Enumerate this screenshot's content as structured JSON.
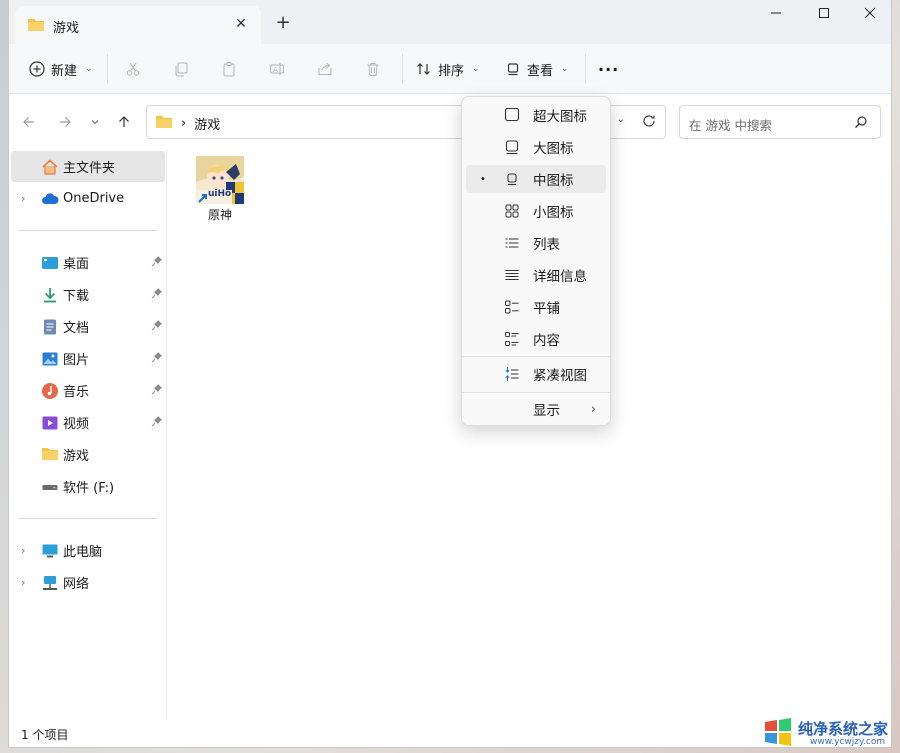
{
  "window": {
    "tab_title": "游戏",
    "tab_close": "✕",
    "new_tab": "+",
    "minimize": "—",
    "maximize": "☐",
    "close": "✕"
  },
  "toolbar": {
    "new_label": "新建",
    "sort_label": "排序",
    "view_label": "查看",
    "more_label": "···",
    "icons": [
      "cut-icon",
      "copy-icon",
      "paste-icon",
      "rename-icon",
      "share-icon",
      "delete-icon"
    ]
  },
  "address": {
    "crumb_separator": "›",
    "current_folder": "游戏",
    "search_placeholder": "在 游戏 中搜索"
  },
  "sidebar": {
    "items": [
      {
        "label": "主文件夹",
        "icon": "home-icon",
        "selected": true
      },
      {
        "label": "OneDrive",
        "icon": "cloud-icon",
        "expandable": true
      },
      {
        "label": "桌面",
        "icon": "desktop-icon",
        "pinned": true
      },
      {
        "label": "下载",
        "icon": "download-icon",
        "pinned": true
      },
      {
        "label": "文档",
        "icon": "document-icon",
        "pinned": true
      },
      {
        "label": "图片",
        "icon": "picture-icon",
        "pinned": true
      },
      {
        "label": "音乐",
        "icon": "music-icon",
        "pinned": true
      },
      {
        "label": "视频",
        "icon": "video-icon",
        "pinned": true
      },
      {
        "label": "游戏",
        "icon": "folder-icon"
      },
      {
        "label": "软件 (F:)",
        "icon": "drive-icon"
      },
      {
        "label": "此电脑",
        "icon": "computer-icon",
        "expandable": true
      },
      {
        "label": "网络",
        "icon": "network-icon",
        "expandable": true
      }
    ]
  },
  "content": {
    "files": [
      {
        "name": "原神",
        "thumb_text": "uiHo",
        "icon": "shortcut-icon"
      }
    ]
  },
  "status": {
    "item_count": "1 个项目"
  },
  "view_menu": {
    "items": [
      {
        "label": "超大图标",
        "icon": "extra-large-icons-icon"
      },
      {
        "label": "大图标",
        "icon": "large-icons-icon"
      },
      {
        "label": "中图标",
        "icon": "medium-icons-icon",
        "selected": true,
        "bullet": "•"
      },
      {
        "label": "小图标",
        "icon": "small-icons-icon"
      },
      {
        "label": "列表",
        "icon": "list-icon"
      },
      {
        "label": "详细信息",
        "icon": "details-icon"
      },
      {
        "label": "平铺",
        "icon": "tiles-icon"
      },
      {
        "label": "内容",
        "icon": "content-icon"
      },
      {
        "label": "紧凑视图",
        "icon": "compact-view-icon"
      },
      {
        "label": "显示",
        "icon": "",
        "submenu": "›"
      }
    ]
  },
  "watermark": {
    "title": "纯净系统之家",
    "url": "www.ycwjzy.com"
  },
  "colors": {
    "folder": "#f5c542",
    "accent": "#2a5fb8",
    "selected_bg": "#e6e6e6"
  }
}
